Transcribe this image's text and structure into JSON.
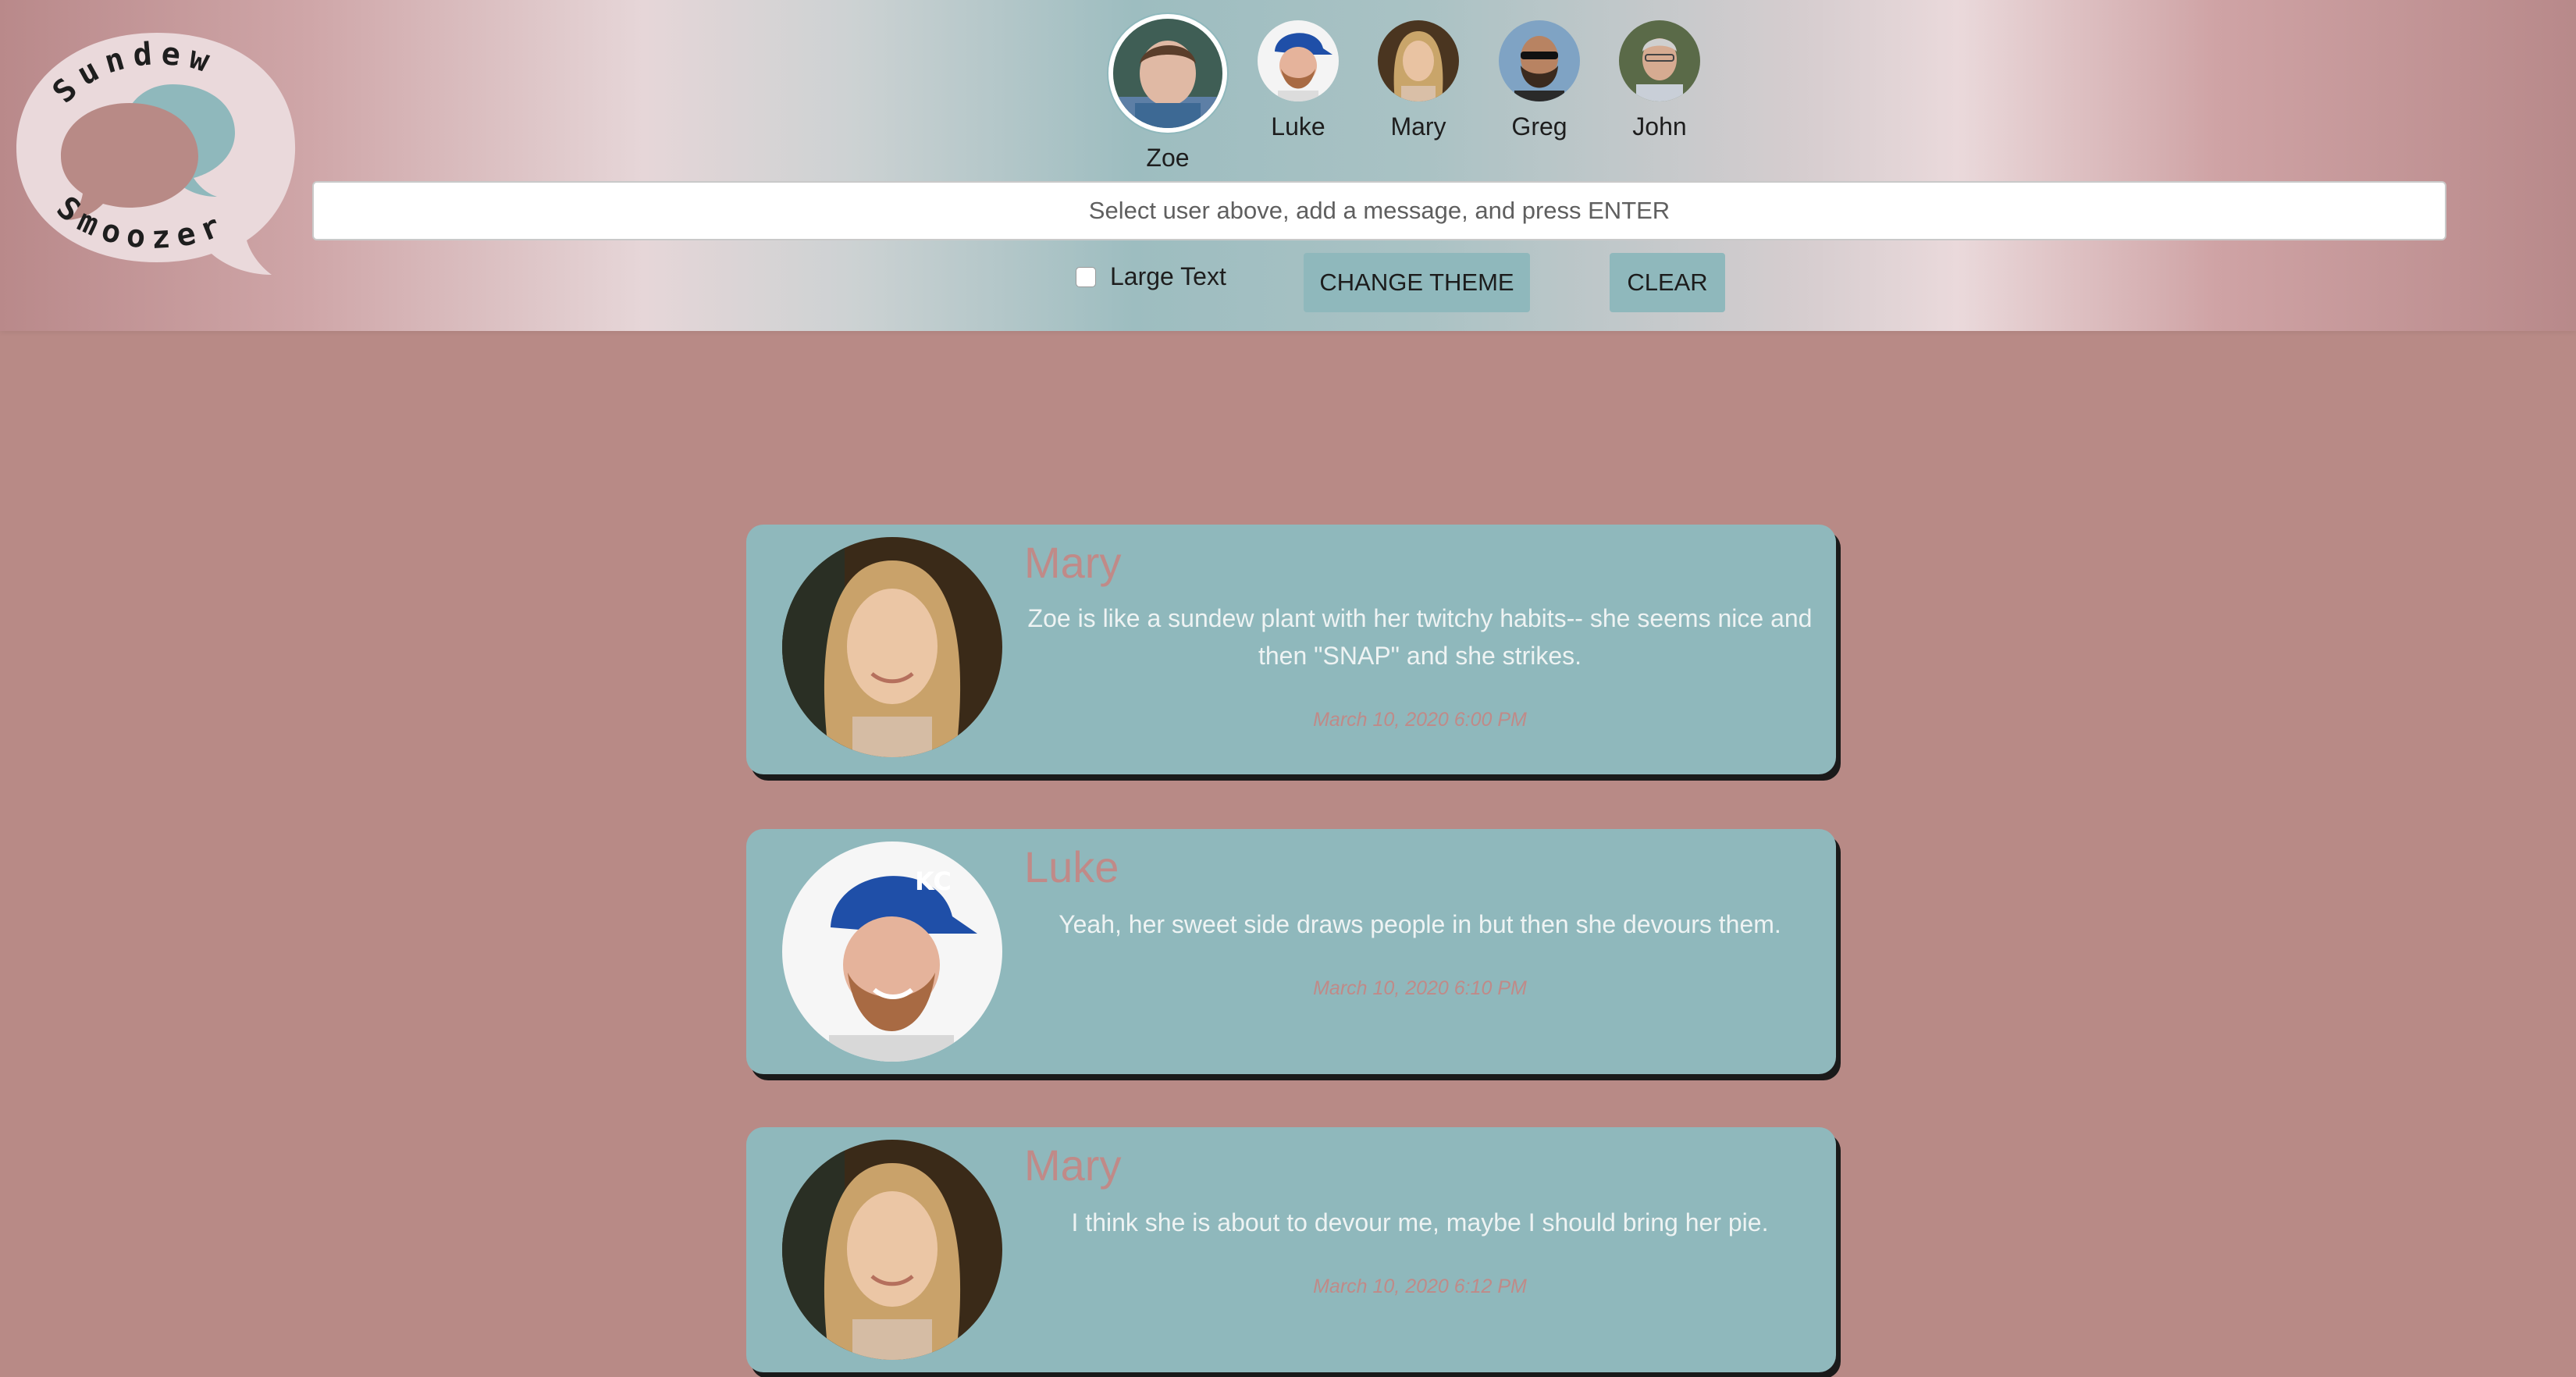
{
  "logo": {
    "top_text": "Sundew",
    "bottom_text": "Smoozer"
  },
  "users": [
    {
      "name": "Zoe",
      "selected": true
    },
    {
      "name": "Luke",
      "selected": false
    },
    {
      "name": "Mary",
      "selected": false
    },
    {
      "name": "Greg",
      "selected": false
    },
    {
      "name": "John",
      "selected": false
    }
  ],
  "composer": {
    "placeholder": "Select user above, add a message, and press ENTER",
    "large_text_label": "Large Text",
    "change_theme_label": "CHANGE THEME",
    "clear_label": "CLEAR"
  },
  "messages": [
    {
      "author": "Mary",
      "text": "Zoe is like a sundew plant with her twitchy habits-- she seems nice and then \"SNAP\" and she strikes.",
      "time": "March 10, 2020 6:00 PM"
    },
    {
      "author": "Luke",
      "text": "Yeah, her sweet side draws people in but then she devours them.",
      "time": "March 10, 2020 6:10 PM"
    },
    {
      "author": "Mary",
      "text": "I think she is about to devour me, maybe I should bring her pie.",
      "time": "March 10, 2020 6:12 PM"
    }
  ],
  "colors": {
    "background": "#b88a86",
    "card": "#8fb8bc",
    "author_text": "#c08a88",
    "button": "#8fb8bc"
  }
}
